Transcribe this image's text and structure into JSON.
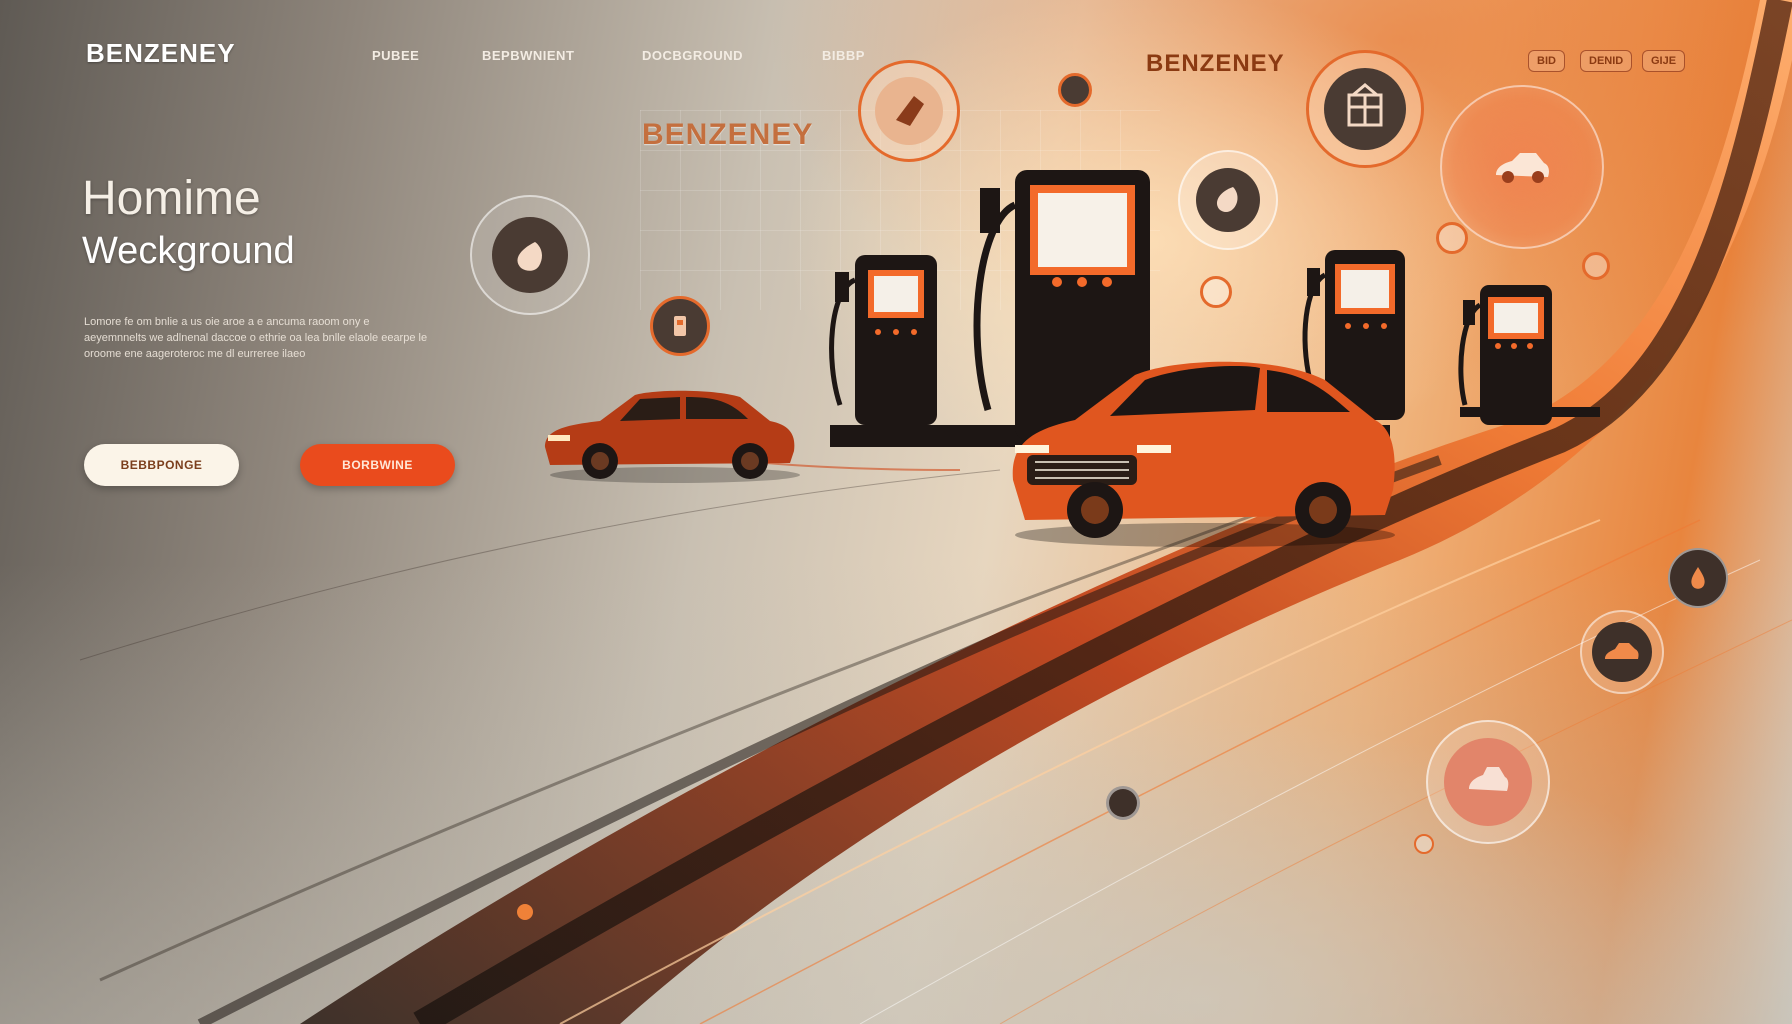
{
  "header": {
    "logo": "BENZENEY",
    "nav_links": [
      "PUBEE",
      "BEPBWNIENT",
      "DOCBGROUND",
      "BIBBP"
    ],
    "center_brand": "BENZENEY",
    "floating_brand": "BENZENEY",
    "pill_buttons": [
      "BID",
      "DENID",
      "GIJE"
    ]
  },
  "hero": {
    "title": "Homime",
    "subtitle": "Weckground",
    "body": "Lomore fe om bnlie a us oie aroe a e ancuma raoom ony e aeyemnnelts we adlnenal daccoe o ethrie oa lea bnlle elaole eearpe le oroome ene aageroteroc me dl eurreree ilaeo",
    "secondary_button": "BEBBPONGE",
    "primary_button": "BORBWINE"
  },
  "icons": [
    "fuel-drop-icon",
    "fuel-nozzle-icon",
    "fuel-nozzle-icon",
    "building-icon",
    "car-icon",
    "fuel-drop-icon",
    "car-icon",
    "car-icon"
  ],
  "colors": {
    "accent": "#ea4b1d",
    "accent_light": "#f07a34",
    "dark_pump": "#1d1614",
    "button_secondary_bg": "#fbf4e8"
  }
}
